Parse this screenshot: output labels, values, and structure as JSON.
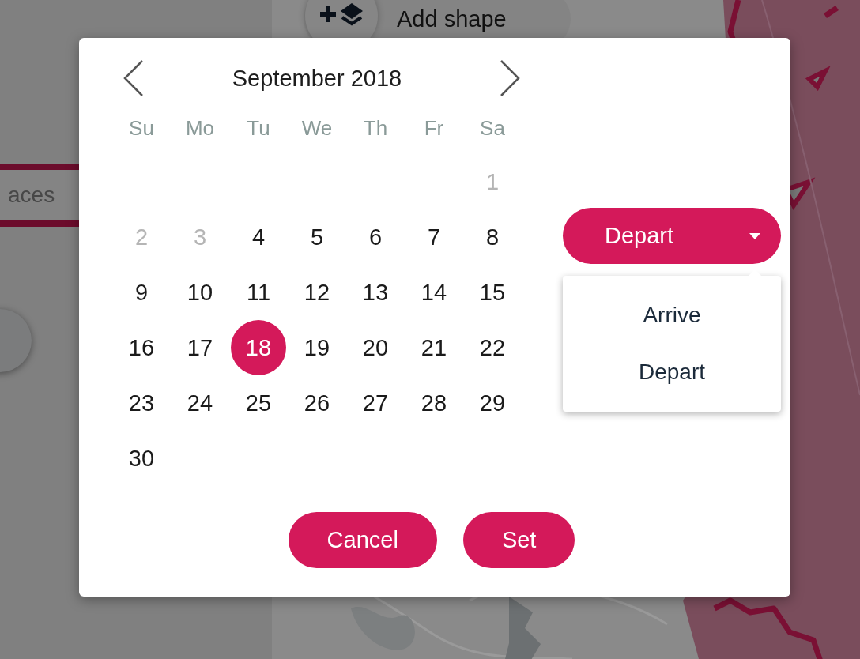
{
  "background": {
    "search_field": {
      "value": "aces"
    },
    "add_shape_button": {
      "label": "Add shape"
    }
  },
  "date_picker": {
    "month_title": "September 2018",
    "weekdays": [
      "Su",
      "Mo",
      "Tu",
      "We",
      "Th",
      "Fr",
      "Sa"
    ],
    "days": [
      {
        "kind": "blank"
      },
      {
        "kind": "blank"
      },
      {
        "kind": "blank"
      },
      {
        "kind": "blank"
      },
      {
        "kind": "blank"
      },
      {
        "kind": "blank"
      },
      {
        "kind": "day",
        "label": "1",
        "disabled": true,
        "selected": false
      },
      {
        "kind": "day",
        "label": "2",
        "disabled": true,
        "selected": false
      },
      {
        "kind": "day",
        "label": "3",
        "disabled": true,
        "selected": false
      },
      {
        "kind": "day",
        "label": "4",
        "disabled": false,
        "selected": false
      },
      {
        "kind": "day",
        "label": "5",
        "disabled": false,
        "selected": false
      },
      {
        "kind": "day",
        "label": "6",
        "disabled": false,
        "selected": false
      },
      {
        "kind": "day",
        "label": "7",
        "disabled": false,
        "selected": false
      },
      {
        "kind": "day",
        "label": "8",
        "disabled": false,
        "selected": false
      },
      {
        "kind": "day",
        "label": "9",
        "disabled": false,
        "selected": false
      },
      {
        "kind": "day",
        "label": "10",
        "disabled": false,
        "selected": false
      },
      {
        "kind": "day",
        "label": "11",
        "disabled": false,
        "selected": false
      },
      {
        "kind": "day",
        "label": "12",
        "disabled": false,
        "selected": false
      },
      {
        "kind": "day",
        "label": "13",
        "disabled": false,
        "selected": false
      },
      {
        "kind": "day",
        "label": "14",
        "disabled": false,
        "selected": false
      },
      {
        "kind": "day",
        "label": "15",
        "disabled": false,
        "selected": false
      },
      {
        "kind": "day",
        "label": "16",
        "disabled": false,
        "selected": false
      },
      {
        "kind": "day",
        "label": "17",
        "disabled": false,
        "selected": false
      },
      {
        "kind": "day",
        "label": "18",
        "disabled": false,
        "selected": true
      },
      {
        "kind": "day",
        "label": "19",
        "disabled": false,
        "selected": false
      },
      {
        "kind": "day",
        "label": "20",
        "disabled": false,
        "selected": false
      },
      {
        "kind": "day",
        "label": "21",
        "disabled": false,
        "selected": false
      },
      {
        "kind": "day",
        "label": "22",
        "disabled": false,
        "selected": false
      },
      {
        "kind": "day",
        "label": "23",
        "disabled": false,
        "selected": false
      },
      {
        "kind": "day",
        "label": "24",
        "disabled": false,
        "selected": false
      },
      {
        "kind": "day",
        "label": "25",
        "disabled": false,
        "selected": false
      },
      {
        "kind": "day",
        "label": "26",
        "disabled": false,
        "selected": false
      },
      {
        "kind": "day",
        "label": "27",
        "disabled": false,
        "selected": false
      },
      {
        "kind": "day",
        "label": "28",
        "disabled": false,
        "selected": false
      },
      {
        "kind": "day",
        "label": "29",
        "disabled": false,
        "selected": false
      },
      {
        "kind": "day",
        "label": "30",
        "disabled": false,
        "selected": false
      }
    ],
    "mode_dropdown": {
      "label": "Depart",
      "expanded": true,
      "options": [
        {
          "label": "Arrive"
        },
        {
          "label": "Depart"
        }
      ]
    },
    "buttons": [
      "Cancel",
      "Set"
    ]
  }
}
